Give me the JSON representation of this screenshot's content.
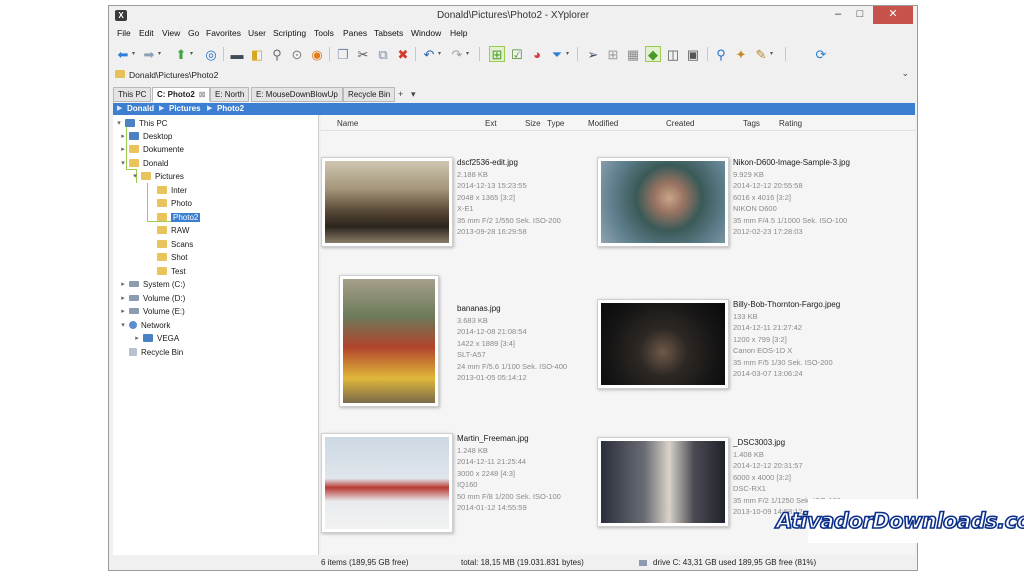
{
  "window": {
    "title": "Donald\\Pictures\\Photo2 - XYplorer",
    "app_icon": "xy-logo-icon",
    "controls": {
      "minimize": "–",
      "maximize": "□",
      "close": "✕"
    }
  },
  "menu": [
    "File",
    "Edit",
    "View",
    "Go",
    "Favorites",
    "User",
    "Scripting",
    "Tools",
    "Panes",
    "Tabsets",
    "Window",
    "Help"
  ],
  "address": {
    "path": "Donald\\Pictures\\Photo2",
    "chevron": "⌄"
  },
  "tabs": [
    {
      "label": "This PC",
      "active": false
    },
    {
      "label": "C: Photo2",
      "active": true,
      "close": "⊠"
    },
    {
      "label": "E: North",
      "active": false
    },
    {
      "label": "E: MouseDownBlowUp",
      "active": false
    },
    {
      "label": "Recycle Bin",
      "active": false
    }
  ],
  "tab_extras": {
    "add": "+",
    "dropdown": "▾"
  },
  "breadcrumb": [
    "Donald",
    "Pictures",
    "Photo2"
  ],
  "tree": {
    "nodes": [
      {
        "label": "This PC",
        "icon": "pc"
      },
      {
        "label": "Desktop",
        "icon": "pc"
      },
      {
        "label": "Dokumente",
        "icon": "folder"
      },
      {
        "label": "Donald",
        "icon": "folder"
      },
      {
        "label": "Pictures",
        "icon": "folder"
      },
      {
        "label": "Inter",
        "icon": "folder"
      },
      {
        "label": "Photo",
        "icon": "folder"
      },
      {
        "label": "Photo2",
        "icon": "folder",
        "selected": true
      },
      {
        "label": "RAW",
        "icon": "folder"
      },
      {
        "label": "Scans",
        "icon": "folder"
      },
      {
        "label": "Shot",
        "icon": "folder"
      },
      {
        "label": "Test",
        "icon": "folder"
      },
      {
        "label": "System (C:)",
        "icon": "drive"
      },
      {
        "label": "Volume (D:)",
        "icon": "drive"
      },
      {
        "label": "Volume (E:)",
        "icon": "drive"
      },
      {
        "label": "Network",
        "icon": "net"
      },
      {
        "label": "VEGA",
        "icon": "pc"
      },
      {
        "label": "Recycle Bin",
        "icon": "bin"
      }
    ]
  },
  "columns": [
    "Name",
    "Ext",
    "Size",
    "Type",
    "Modified",
    "Created",
    "Tags",
    "Rating"
  ],
  "items": [
    {
      "name": "dscf2536-edit.jpg",
      "lines": [
        "2.188 KB",
        "2014-12-13 15:23:55",
        "2048 x 1365  [3:2]",
        "X-E1",
        "35 mm  F/2  1/550 Sek.  ISO-200",
        "2013-09-28 16:29:58"
      ]
    },
    {
      "name": "Nikon-D600-Image-Sample-3.jpg",
      "lines": [
        "9.929 KB",
        "2014-12-12 20:55:58",
        "6016 x 4016  [3:2]",
        "NIKON D600",
        "35 mm  F/4.5  1/1000 Sek.  ISO-100",
        "2012-02-23 17:28:03"
      ]
    },
    {
      "name": "bananas.jpg",
      "lines": [
        "3.683 KB",
        "2014-12-08 21:08:54",
        "1422 x 1889  [3:4]",
        "SLT-A57",
        "24 mm  F/5.6  1/100 Sek.  ISO-400",
        "2013-01-05 05:14:12"
      ]
    },
    {
      "name": "Billy-Bob-Thornton-Fargo.jpeg",
      "lines": [
        "133 KB",
        "2014-12-11 21:27:42",
        "1200 x 799  [3:2]",
        "Canon EOS-1D X",
        "35 mm  F/5  1/30 Sek.  ISO-200",
        "2014-03-07 13:06:24"
      ]
    },
    {
      "name": "Martin_Freeman.jpg",
      "lines": [
        "1.248 KB",
        "2014-12-11 21:25:44",
        "3000 x 2248  [4:3]",
        "IQ160",
        "50 mm  F/8  1/200 Sek.  ISO-100",
        "2014-01-12 14:55:59"
      ]
    },
    {
      "name": "_DSC3003.jpg",
      "lines": [
        "1.408 KB",
        "2014-12-12 20:31:57",
        "6000 x 4000  [3:2]",
        "DSC-RX1",
        "35 mm  F/2  1/1250 Sek.  ISO-100",
        "2013-10-09 14:58:12"
      ]
    }
  ],
  "status": {
    "items": "6 items (189,95 GB free)",
    "total": "total: 18,15 MB (19.031.831 bytes)",
    "drive": "drive C:  43,31 GB used   189,95 GB free (81%)"
  },
  "watermark": "AtivadorDownloads.com",
  "toolbar_icons": [
    "back-arrow-icon",
    "forward-arrow-icon",
    "up-arrow-icon",
    "target-icon",
    "computer-icon",
    "find-files-icon",
    "search-magnifier-icon",
    "play-icon",
    "script-icon",
    "copy-path-icon",
    "cut-icon",
    "copy-icon",
    "delete-icon",
    "undo-icon",
    "redo-icon",
    "tree-toggle-icon",
    "checkbox-icon",
    "pie-chart-icon",
    "filter-icon",
    "send-icon",
    "thumbnails-icon",
    "catalog-icon",
    "tag-icon",
    "dual-pane-icon",
    "pane-one-icon",
    "zoom-icon",
    "tools-icon",
    "brush-icon",
    "refresh-icon"
  ],
  "colors": {
    "accent": "#3c7fd1",
    "close": "#c7514b",
    "tree_guide": "#9ccc4e"
  }
}
